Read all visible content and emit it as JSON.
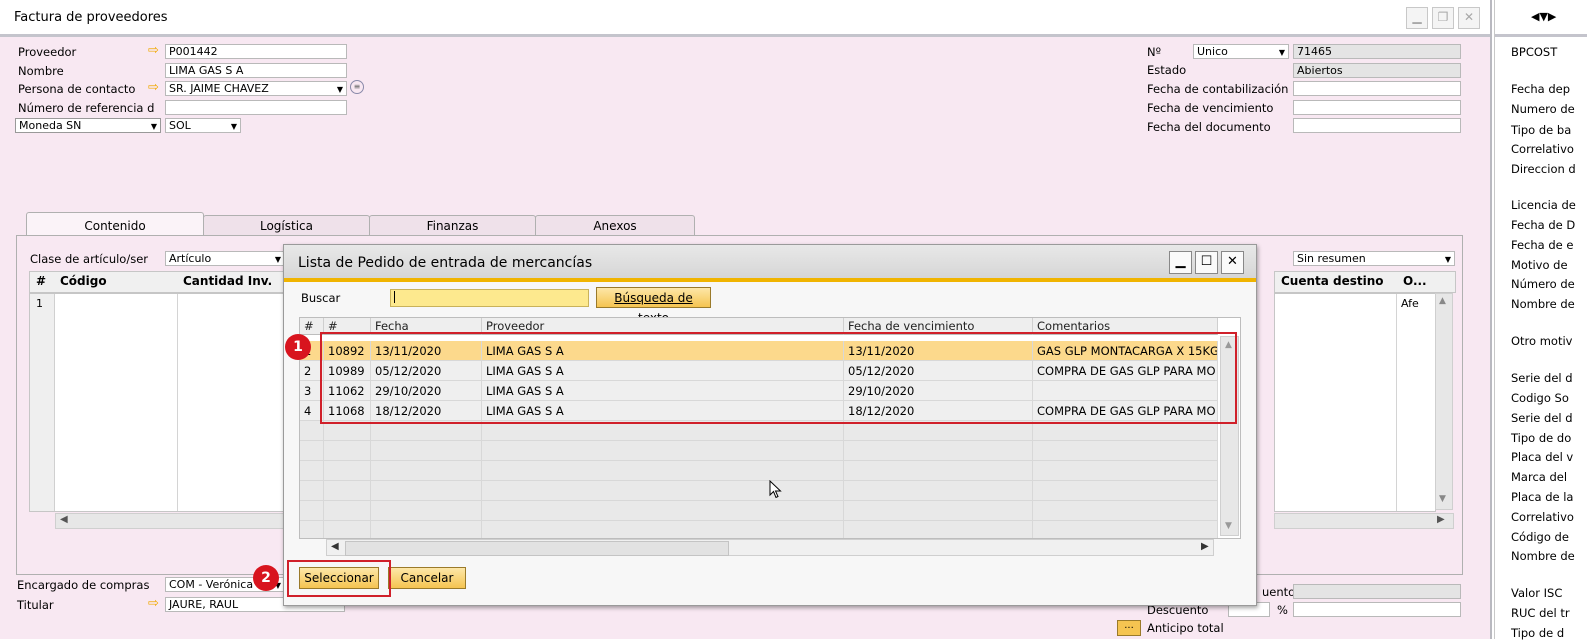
{
  "window": {
    "title": "Factura de proveedores"
  },
  "header_left": {
    "proveedor_label": "Proveedor",
    "proveedor_value": "P001442",
    "nombre_label": "Nombre",
    "nombre_value": "LIMA GAS S A",
    "contacto_label": "Persona de contacto",
    "contacto_value": "SR. JAIME CHAVEZ",
    "referencia_label": "Número de referencia d",
    "referencia_value": "",
    "moneda_label": "Moneda SN",
    "moneda_value": "SOL"
  },
  "header_right": {
    "numero_label": "Nº",
    "serie_value": "Unico",
    "numero_value": "71465",
    "estado_label": "Estado",
    "estado_value": "Abiertos",
    "contab_label": "Fecha de contabilización",
    "venc_label": "Fecha de vencimiento",
    "doc_label": "Fecha del documento"
  },
  "tabs": [
    "Contenido",
    "Logística",
    "Finanzas",
    "Anexos"
  ],
  "content": {
    "clase_label": "Clase de artículo/ser",
    "clase_value": "Artículo",
    "resumen_value": "Sin resumen",
    "grid_headers": [
      "#",
      "Código",
      "Cantidad Inv."
    ],
    "grid_right_headers": [
      "Cuenta destino",
      "O..."
    ],
    "first_row_num": "1",
    "first_row_right": "Afe"
  },
  "footer": {
    "encargado_label": "Encargado de compras",
    "encargado_value": "COM - Verónica",
    "titular_label": "Titular",
    "titular_value": "JAURE, RAUL",
    "descuento_label": "Descuento",
    "percent": "%",
    "anticipo_label": "Anticipo total",
    "uento_label": "uento",
    "more_button": "..."
  },
  "side_panel": {
    "code": "BPCOST",
    "labels": [
      "Fecha dep",
      "Numero de",
      "Tipo de ba",
      "Correlativo",
      "Direccion d",
      "Licencia de",
      "Fecha de D",
      "Fecha de e",
      "Motivo de",
      "Número de",
      "Nombre de",
      "Otro motiv",
      "Serie del d",
      "Codigo So",
      "Serie del d",
      "Tipo de do",
      "Placa del v",
      "Marca del",
      "Placa de la",
      "Correlativo",
      "Código de",
      "Nombre de",
      "Valor ISC",
      "RUC del tr",
      "Tipo de d"
    ]
  },
  "dialog": {
    "title": "Lista de Pedido de entrada de mercancías",
    "search_label": "Buscar",
    "search_value": "",
    "search_button": "Búsqueda de texto",
    "columns": [
      "#",
      "#",
      "Fecha",
      "Proveedor",
      "Fecha de vencimiento",
      "Comentarios"
    ],
    "rows": [
      {
        "idx": "1",
        "num": "10892",
        "fecha": "13/11/2020",
        "proveedor": "LIMA GAS S A",
        "venc": "13/11/2020",
        "coment": "GAS GLP MONTACARGA X 15KG"
      },
      {
        "idx": "2",
        "num": "10989",
        "fecha": "05/12/2020",
        "proveedor": "LIMA GAS S A",
        "venc": "05/12/2020",
        "coment": "COMPRA DE GAS GLP PARA MO"
      },
      {
        "idx": "3",
        "num": "11062",
        "fecha": "29/10/2020",
        "proveedor": "LIMA GAS S A",
        "venc": "29/10/2020",
        "coment": ""
      },
      {
        "idx": "4",
        "num": "11068",
        "fecha": "18/12/2020",
        "proveedor": "LIMA GAS S A",
        "venc": "18/12/2020",
        "coment": "COMPRA DE GAS GLP PARA MO"
      }
    ],
    "select_button": "Seleccionar",
    "cancel_button": "Cancelar"
  },
  "annotations": {
    "badge1": "1",
    "badge2": "2"
  },
  "colors": {
    "accent": "#f0b400",
    "highlight": "#d0202a",
    "window_bg": "#f8e8f2"
  }
}
